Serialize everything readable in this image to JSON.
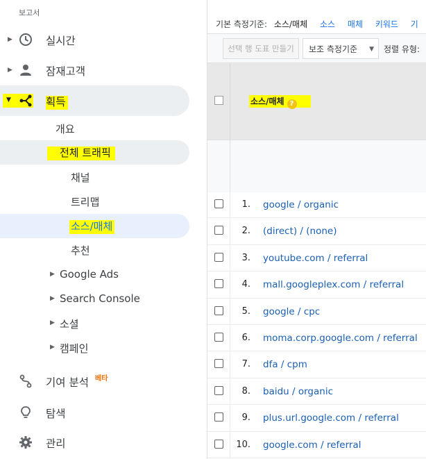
{
  "sidebar": {
    "section_title": "보고서",
    "realtime": {
      "label": "실시간",
      "icon": "clock-icon"
    },
    "audience": {
      "label": "잠재고객",
      "icon": "person-icon"
    },
    "acquisition": {
      "label": "획득",
      "icon": "acquisition-icon"
    },
    "acquisition_children": {
      "overview": "개요",
      "all_traffic": "전체 트래픽",
      "all_traffic_children": [
        "채널",
        "트리맵",
        "소스/매체",
        "추천"
      ],
      "google_ads": "Google Ads",
      "search_console": "Search Console",
      "social": "소셜",
      "campaigns": "캠페인"
    },
    "attribution": {
      "label": "기여 분석",
      "badge": "베타",
      "icon": "attribution-icon"
    },
    "discover": {
      "label": "탐색",
      "icon": "lightbulb-icon"
    },
    "admin": {
      "label": "관리",
      "icon": "gear-icon"
    }
  },
  "main": {
    "dimension_bar": {
      "label": "기본 측정기준:",
      "active": "소스/매체",
      "links": [
        "소스",
        "매체",
        "키워드",
        "기"
      ]
    },
    "toolbar": {
      "pivot_button": "선택 행 도표 만들기",
      "secondary_dimension": "보조 측정기준",
      "sort_label": "정렬 유형:"
    },
    "table": {
      "header": "소스/매체",
      "help": "?",
      "rows": [
        {
          "num": "1.",
          "source": "google / organic"
        },
        {
          "num": "2.",
          "source": "(direct) / (none)"
        },
        {
          "num": "3.",
          "source": "youtube.com / referral"
        },
        {
          "num": "4.",
          "source": "mall.googleplex.com / referral"
        },
        {
          "num": "5.",
          "source": "google / cpc"
        },
        {
          "num": "6.",
          "source": "moma.corp.google.com / referral"
        },
        {
          "num": "7.",
          "source": "dfa / cpm"
        },
        {
          "num": "8.",
          "source": "baidu / organic"
        },
        {
          "num": "9.",
          "source": "plus.url.google.com / referral"
        },
        {
          "num": "10.",
          "source": "google.com / referral"
        }
      ]
    }
  },
  "colors": {
    "highlight": "#ffff00",
    "link": "#1a73e8",
    "selected_bg": "#e8f0fe",
    "beta": "#e8710a"
  }
}
